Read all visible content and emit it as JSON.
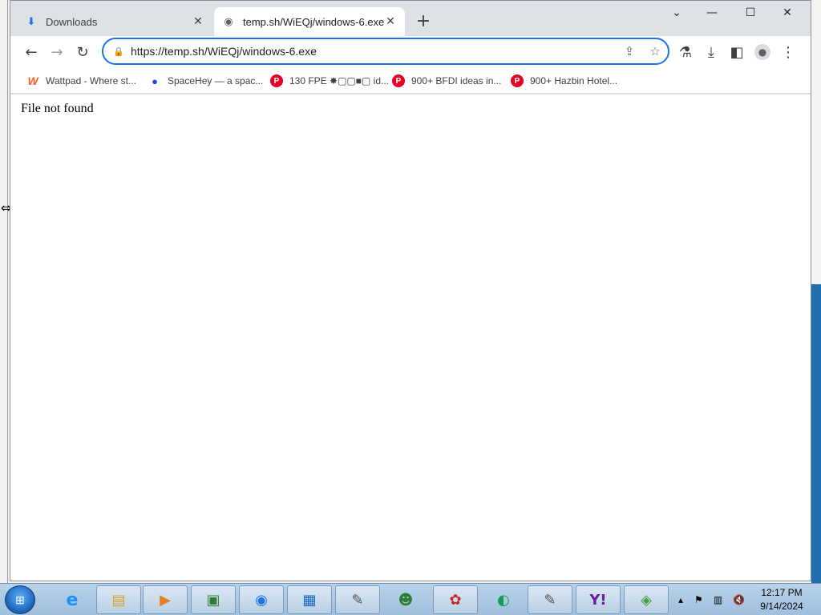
{
  "tabs": [
    {
      "title": "Downloads",
      "icon": "download-icon"
    },
    {
      "title": "temp.sh/WiEQj/windows-6.exe",
      "icon": "globe-icon"
    }
  ],
  "window_controls": {
    "dropdown": "⌄",
    "minimize": "—",
    "maximize": "☐",
    "close": "✕"
  },
  "address_bar": {
    "url": "https://temp.sh/WiEQj/windows-6.exe"
  },
  "bookmarks": [
    {
      "label": "Wattpad - Where st...",
      "icon": "wattpad-icon"
    },
    {
      "label": "SpaceHey — a spac...",
      "icon": "spacehey-icon"
    },
    {
      "label": "130 FPE ✸▢▢■▢ id...",
      "icon": "pinterest-icon"
    },
    {
      "label": "900+ BFDI ideas in...",
      "icon": "pinterest-icon"
    },
    {
      "label": "900+ Hazbin Hotel...",
      "icon": "pinterest-icon"
    }
  ],
  "page": {
    "message": "File not found"
  },
  "taskbar": {
    "items": [
      "internet-explorer-icon",
      "file-explorer-icon",
      "media-player-icon",
      "program-icon",
      "chrome-icon",
      "program-icon",
      "program-icon",
      "people-icon",
      "paint-icon",
      "edge-icon",
      "program-icon",
      "yahoo-messenger-icon",
      "bluestacks-icon"
    ],
    "clock_time": "12:17 PM",
    "clock_date": "9/14/2024"
  },
  "colors": {
    "accent": "#1a73e8",
    "tabstrip": "#dee1e6",
    "taskbar": "#b9d3ea"
  }
}
